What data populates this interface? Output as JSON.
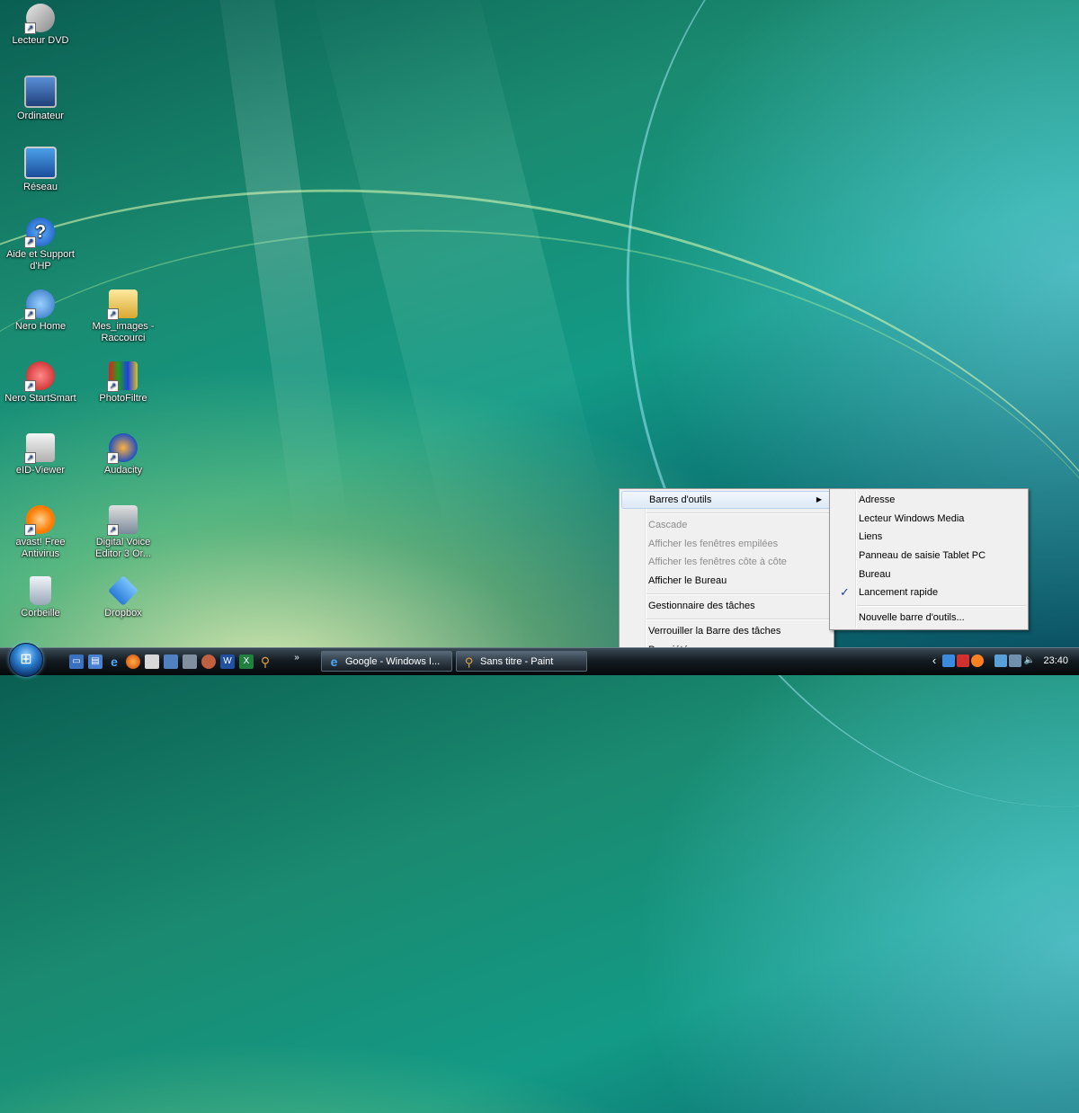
{
  "desktop": {
    "icons": [
      {
        "label": "Lecteur DVD",
        "icon": "dvd-drive-icon"
      },
      {
        "label": "Ordinateur",
        "icon": "computer-icon"
      },
      {
        "label": "Réseau",
        "icon": "network-icon"
      },
      {
        "label": "Aide et Support d'HP",
        "icon": "help-icon"
      },
      {
        "label": "Nero Home",
        "icon": "nero-home-icon"
      },
      {
        "label": "Mes_images - Raccourci",
        "icon": "folder-icon"
      },
      {
        "label": "Nero StartSmart",
        "icon": "nero-startsmart-icon"
      },
      {
        "label": "PhotoFiltre",
        "icon": "photofiltre-icon"
      },
      {
        "label": "eID-Viewer",
        "icon": "eid-viewer-icon"
      },
      {
        "label": "Audacity",
        "icon": "audacity-icon"
      },
      {
        "label": "avast! Free Antivirus",
        "icon": "avast-icon"
      },
      {
        "label": "Digital Voice Editor 3 Or...",
        "icon": "voice-editor-icon"
      },
      {
        "label": "Corbeille",
        "icon": "recycle-bin-icon"
      },
      {
        "label": "Dropbox",
        "icon": "dropbox-icon"
      }
    ]
  },
  "context_menu": {
    "items": [
      {
        "label": "Barres d'outils",
        "enabled": true,
        "submenu": true
      },
      {
        "label": "Cascade",
        "enabled": false
      },
      {
        "label": "Afficher les fenêtres empilées",
        "enabled": false
      },
      {
        "label": "Afficher les fenêtres côte à côte",
        "enabled": false
      },
      {
        "label": "Afficher le Bureau",
        "enabled": true
      },
      {
        "label": "Gestionnaire des tâches",
        "enabled": true
      },
      {
        "label": "Verrouiller la Barre des tâches",
        "enabled": true
      },
      {
        "label": "Propriétés",
        "enabled": true
      }
    ]
  },
  "toolbars_submenu": {
    "items": [
      {
        "label": "Adresse",
        "checked": false
      },
      {
        "label": "Lecteur Windows Media",
        "checked": false
      },
      {
        "label": "Liens",
        "checked": false
      },
      {
        "label": "Panneau de saisie Tablet PC",
        "checked": false
      },
      {
        "label": "Bureau",
        "checked": false
      },
      {
        "label": "Lancement rapide",
        "checked": true
      },
      {
        "label": "Nouvelle barre d'outils...",
        "checked": false
      }
    ],
    "check_glyph": "✓"
  },
  "taskbar": {
    "quicklaunch_overflow": "»",
    "windows": [
      {
        "label": "Google - Windows I...",
        "icon": "internet-explorer-icon"
      },
      {
        "label": "Sans titre - Paint",
        "icon": "paint-icon"
      }
    ],
    "tray_expand": "‹",
    "clock": "23:40"
  },
  "colors": {
    "menu_bg": "#f0f0f0",
    "menu_hover": "#dce9f7",
    "taskbar": "#141c22"
  }
}
